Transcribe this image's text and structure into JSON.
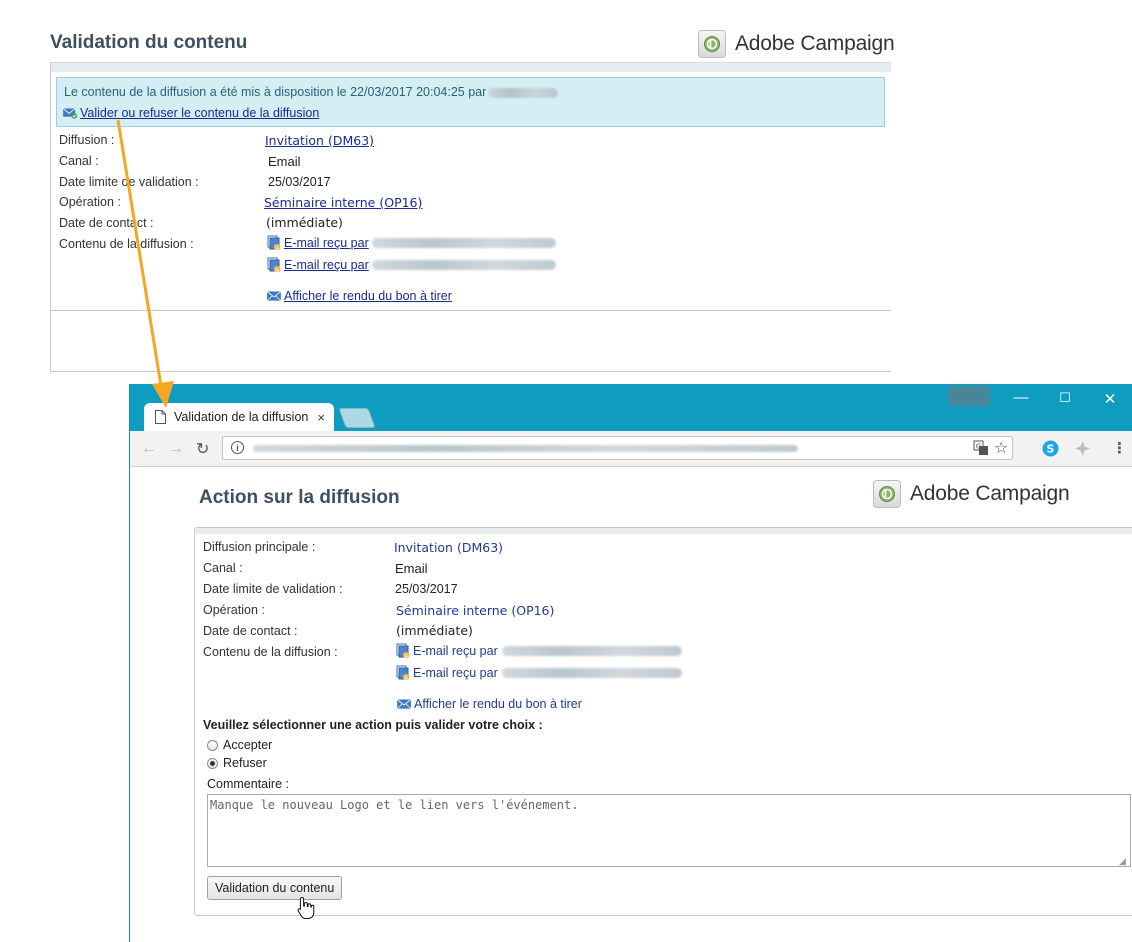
{
  "email": {
    "title": "Validation du contenu",
    "brand": "Adobe Campaign",
    "notice_text": "Le contenu de la diffusion a été mis à disposition le 22/03/2017 20:04:25 par",
    "notice_link": "Valider ou refuser le contenu de la diffusion",
    "rows": {
      "diffusion_label": "Diffusion :",
      "diffusion_value": "Invitation (DM63)",
      "canal_label": "Canal :",
      "canal_value": "Email",
      "date_limite_label": "Date limite de validation :",
      "date_limite_value": "25/03/2017",
      "operation_label": "Opération :",
      "operation_value": "Séminaire interne (OP16)",
      "date_contact_label": "Date de contact :",
      "date_contact_value": "(immédiate)",
      "contenu_label": "Contenu de la diffusion :",
      "proof_1": "E-mail reçu par",
      "proof_2": "E-mail reçu par",
      "bat_link": "Afficher le rendu du bon à tirer"
    }
  },
  "browser": {
    "tab_title": "Validation de la diffusion",
    "tab_close": "×",
    "window_buttons": [
      "—",
      "☐",
      "✕"
    ]
  },
  "page": {
    "title": "Action sur la diffusion",
    "brand": "Adobe Campaign",
    "rows": {
      "diffusion_label": "Diffusion principale :",
      "diffusion_value": "Invitation (DM63)",
      "canal_label": "Canal :",
      "canal_value": "Email",
      "date_limite_label": "Date limite de validation :",
      "date_limite_value": "25/03/2017",
      "operation_label": "Opération :",
      "operation_value": "Séminaire interne (OP16)",
      "date_contact_label": "Date de contact :",
      "date_contact_value": "(immédiate)",
      "contenu_label": "Contenu de la diffusion :",
      "proof_1": "E-mail reçu par",
      "proof_2": "E-mail reçu par",
      "bat_link": "Afficher le rendu du bon à tirer"
    },
    "action_prompt": "Veuillez sélectionner une action puis valider votre choix :",
    "options": [
      {
        "label": "Accepter",
        "selected": false
      },
      {
        "label": "Refuser",
        "selected": true
      }
    ],
    "comment_label": "Commentaire :",
    "comment_value": "Manque le nouveau Logo et le lien vers l'événement.",
    "submit_label": "Validation du contenu"
  },
  "colors": {
    "title_color": "#3d4f61",
    "link_color": "#1a2b8f",
    "notice_bg": "#d4eef4",
    "browser_titlebar": "#0e9cc1",
    "arrow": "#f5a623"
  }
}
